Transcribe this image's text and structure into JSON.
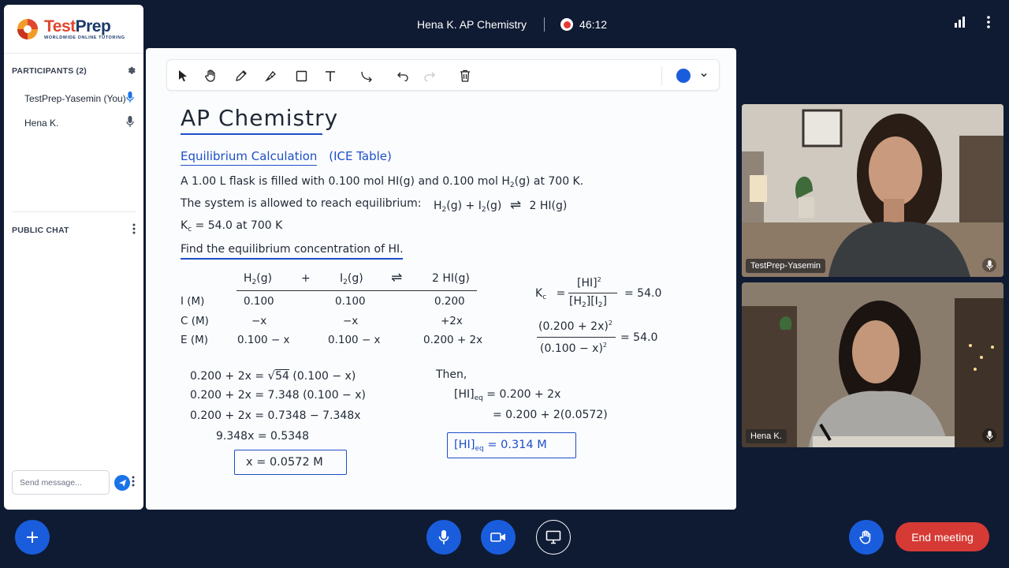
{
  "meeting": {
    "title": "Hena K. AP Chemistry",
    "timer": "46:12"
  },
  "brand": {
    "name_part1": "Test",
    "name_part2": "Prep",
    "tagline": "WORLDWIDE ONLINE TUTORING"
  },
  "participants": {
    "header": "PARTICIPANTS (2)",
    "items": [
      {
        "name": "TestPrep-Yasemin (You)",
        "mic_active": true
      },
      {
        "name": "Hena K.",
        "mic_active": false
      }
    ]
  },
  "chat": {
    "header": "PUBLIC CHAT",
    "placeholder": "Send message..."
  },
  "toolbar": {
    "tools": [
      "select-icon",
      "hand-icon",
      "pencil-icon",
      "highlighter-icon",
      "rectangle-icon",
      "text-icon",
      "connector-icon",
      "undo-icon",
      "redo-icon",
      "trash-icon"
    ],
    "current_color": "#1a5ddc"
  },
  "board": {
    "title": "AP Chemistry",
    "subtitle_a": "Equilibrium Calculation",
    "subtitle_b": "(ICE Table)",
    "p1": {
      "a": "A 1.00 L flask is filled with 0.100 mol HI(g) and 0.100 mol H",
      "s1": "2",
      "b": "(g) at 700 K."
    },
    "p2": {
      "a": "The system is allowed to reach equilibrium:"
    },
    "reaction": {
      "h": "H",
      "s1": "2",
      "g1": "(g)  +  I",
      "s2": "2",
      "g2": "(g)",
      "arrow": "⇌",
      "hi": "2 HI(g)"
    },
    "kc_line": {
      "k": "K",
      "c": "c",
      "rest": " = 54.0  at  700 K"
    },
    "question": "Find the equilibrium concentration of HI.",
    "ice": {
      "head": {
        "h2": "H",
        "h2s": "2",
        "h2g": "(g)",
        "plus": "+",
        "i2": "I",
        "i2s": "2",
        "i2g": "(g)",
        "arrow": "⇌",
        "hi": "2  HI(g)"
      },
      "rows": [
        {
          "label": "I (M)",
          "c1": "0.100",
          "c2": "0.100",
          "c3": "0.200"
        },
        {
          "label": "C (M)",
          "c1": "−x",
          "c2": "−x",
          "c3": "+2x"
        },
        {
          "label": "E (M)",
          "c1": "0.100 − x",
          "c2": "0.100 − x",
          "c3": "0.200 + 2x"
        }
      ]
    },
    "kc_expr": {
      "k": "K",
      "c": "c",
      "eq": "=",
      "num": "[HI]",
      "sup": "2",
      "den_a": "[H",
      "den_s1": "2",
      "den_b": "][I",
      "den_s2": "2",
      "den_c": "]",
      "val": "=  54.0"
    },
    "kc_sub": {
      "num": "(0.200 + 2x)",
      "num_sup": "2",
      "den": "(0.100 − x)",
      "den_sup": "2",
      "val": "=  54.0"
    },
    "work": {
      "l1a": "0.200  +  2x  =  ",
      "l1r": "54",
      "l1b": "  (0.100 − x)",
      "l2": "0.200  +  2x  =  7.348  (0.100 − x)",
      "l3": "0.200  +  2x  =  0.7348  −  7.348x",
      "l4": "9.348x  =  0.5348",
      "answer_x": "x  =  0.0572  M"
    },
    "then": {
      "label": "Then,",
      "l1a": "[HI]",
      "l1s": "eq",
      "l1b": " = 0.200  +  2x",
      "l2": "=  0.200  +  2(0.0572)",
      "ans_a": "[HI]",
      "ans_s": "eq",
      "ans_b": "  =  0.314  M"
    }
  },
  "videos": [
    {
      "name": "TestPrep-Yasemin"
    },
    {
      "name": "Hena K."
    }
  ],
  "controls": {
    "end_label": "End meeting"
  }
}
